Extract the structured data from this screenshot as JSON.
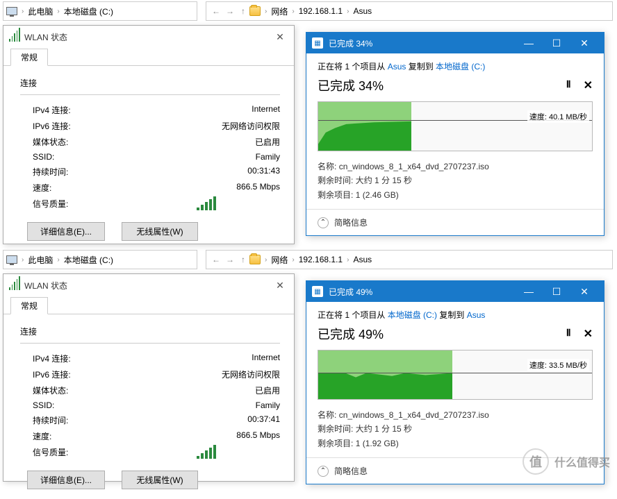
{
  "top": {
    "crumbs_left": {
      "pc": "此电脑",
      "disk": "本地磁盘 (C:)"
    },
    "crumbs_right": {
      "network": "网络",
      "ip": "192.168.1.1",
      "asus": "Asus"
    }
  },
  "bottom": {
    "crumbs_left": {
      "pc": "此电脑",
      "disk": "本地磁盘 (C:)"
    },
    "crumbs_right": {
      "network": "网络",
      "ip": "192.168.1.1",
      "asus": "Asus"
    }
  },
  "wlan": {
    "title": "WLAN 状态",
    "tab": "常规",
    "section": "连接",
    "rows": {
      "ipv4_k": "IPv4 连接:",
      "ipv4_v": "Internet",
      "ipv6_k": "IPv6 连接:",
      "ipv6_v": "无网络访问权限",
      "media_k": "媒体状态:",
      "media_v": "已启用",
      "ssid_k": "SSID:",
      "ssid_v": "Family",
      "dur_k": "持续时间:",
      "speed_k": "速度:",
      "speed_v": "866.5 Mbps",
      "sig_k": "信号质量:"
    },
    "dur_top": "00:31:43",
    "dur_bottom": "00:37:41",
    "btn_detail": "详细信息(E)...",
    "btn_wifiprop": "无线属性(W)"
  },
  "copy": {
    "top": {
      "title": "已完成 34%",
      "status_prefix": "正在将 1 个项目从 ",
      "status_from": "Asus",
      "status_mid": " 复制到 ",
      "status_to": "本地磁盘 (C:)",
      "progress": "已完成 34%",
      "speed": "速度: 40.1 MB/秒",
      "name_k": "名称:",
      "name_v": "cn_windows_8_1_x64_dvd_2707237.iso",
      "time_k": "剩余时间:",
      "time_v": "大约 1 分 15 秒",
      "items_k": "剩余项目:",
      "items_v": "1 (2.46 GB)",
      "less": "简略信息"
    },
    "bottom": {
      "title": "已完成 49%",
      "status_prefix": "正在将 1 个项目从 ",
      "status_from": "本地磁盘 (C:)",
      "status_mid": " 复制到 ",
      "status_to": "Asus",
      "progress": "已完成 49%",
      "speed": "速度: 33.5 MB/秒",
      "name_k": "名称:",
      "name_v": "cn_windows_8_1_x64_dvd_2707237.iso",
      "time_k": "剩余时间:",
      "time_v": "大约 1 分 15 秒",
      "items_k": "剩余项目:",
      "items_v": "1 (1.92 GB)",
      "less": "简略信息"
    }
  },
  "watermark": "什么值得买",
  "chart_data": [
    {
      "type": "area",
      "title": "Copy speed (top)",
      "ylabel": "MB/s",
      "ylim": [
        0,
        60
      ],
      "progress_fraction": 0.34,
      "current_speed": 40.1,
      "series": [
        {
          "name": "speed",
          "values": [
            10,
            28,
            34,
            36,
            38,
            39,
            40,
            40,
            40,
            40.1
          ]
        }
      ]
    },
    {
      "type": "area",
      "title": "Copy speed (bottom)",
      "ylabel": "MB/s",
      "ylim": [
        0,
        60
      ],
      "progress_fraction": 0.49,
      "current_speed": 33.5,
      "series": [
        {
          "name": "speed",
          "values": [
            34,
            34,
            33,
            30,
            34,
            33,
            32,
            34,
            33,
            33.5
          ]
        }
      ]
    }
  ]
}
